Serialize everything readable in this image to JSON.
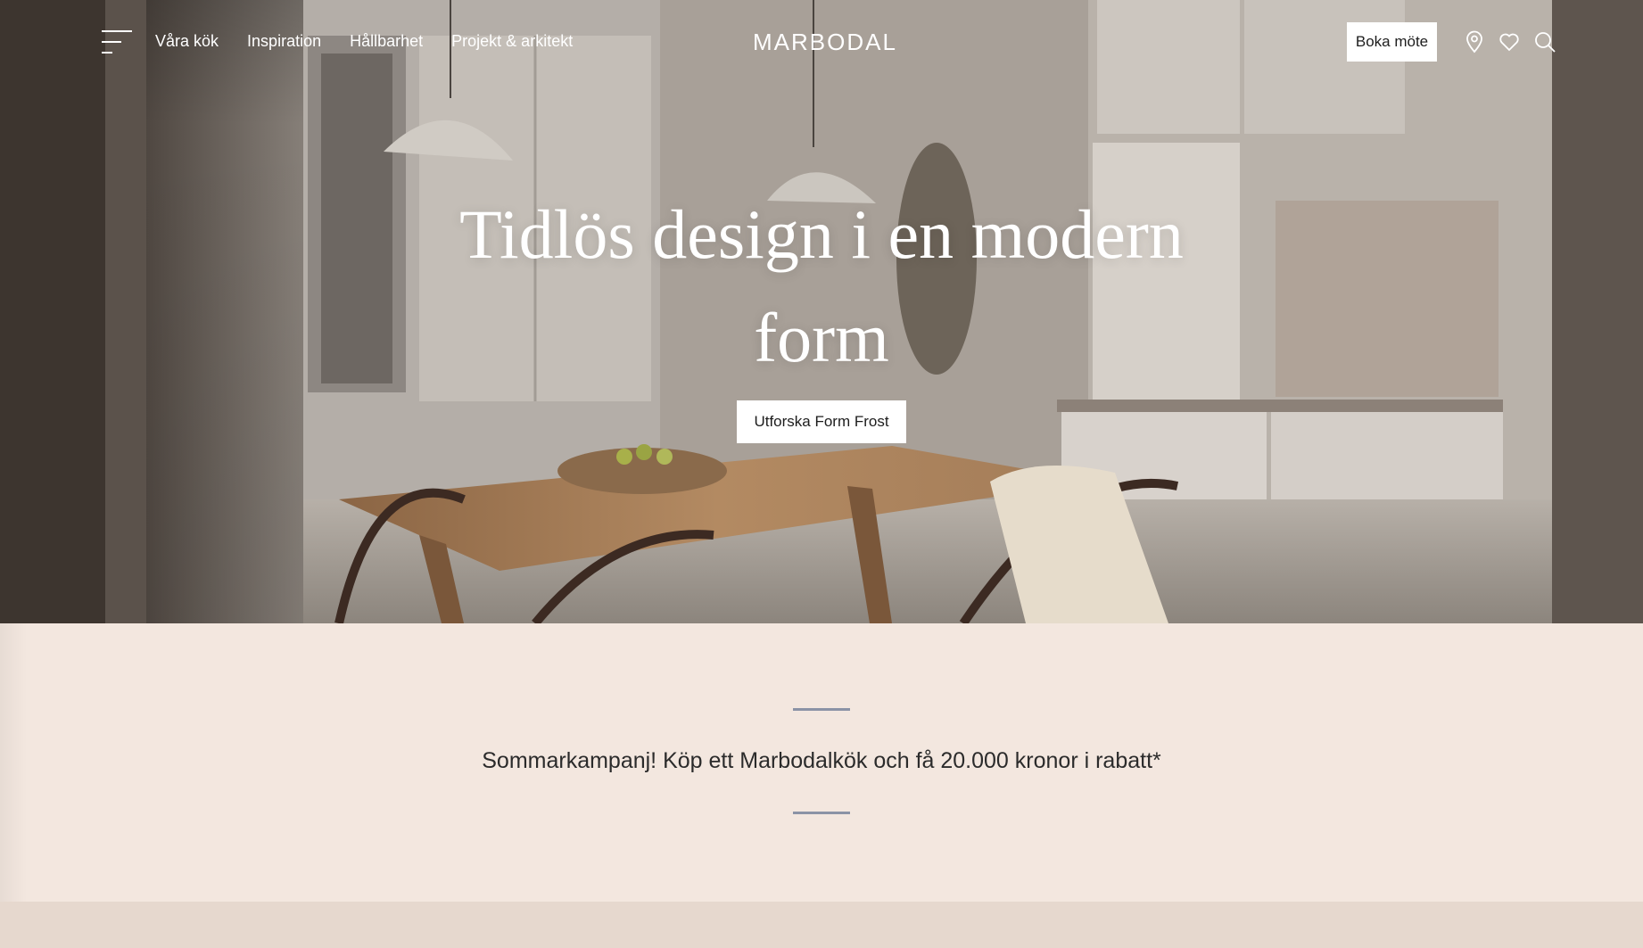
{
  "nav": {
    "links": [
      "Våra kök",
      "Inspiration",
      "Hållbarhet",
      "Projekt & arkitekt"
    ],
    "logo": "MARBODAL",
    "book_button": "Boka möte",
    "icons": [
      "menu-icon",
      "location-pin-icon",
      "heart-icon",
      "search-icon"
    ]
  },
  "hero": {
    "title": "Tidlös design i en modern form",
    "cta_label": "Utforska Form Frost"
  },
  "campaign": {
    "text": "Sommarkampanj! Köp ett Marbodalkök och få 20.000 kronor i rabatt*"
  },
  "colors": {
    "campaign_background": "#f3e7df",
    "divider": "#8b93a6",
    "bottom_band": "#e6d8ce",
    "button_background": "#ffffff"
  }
}
